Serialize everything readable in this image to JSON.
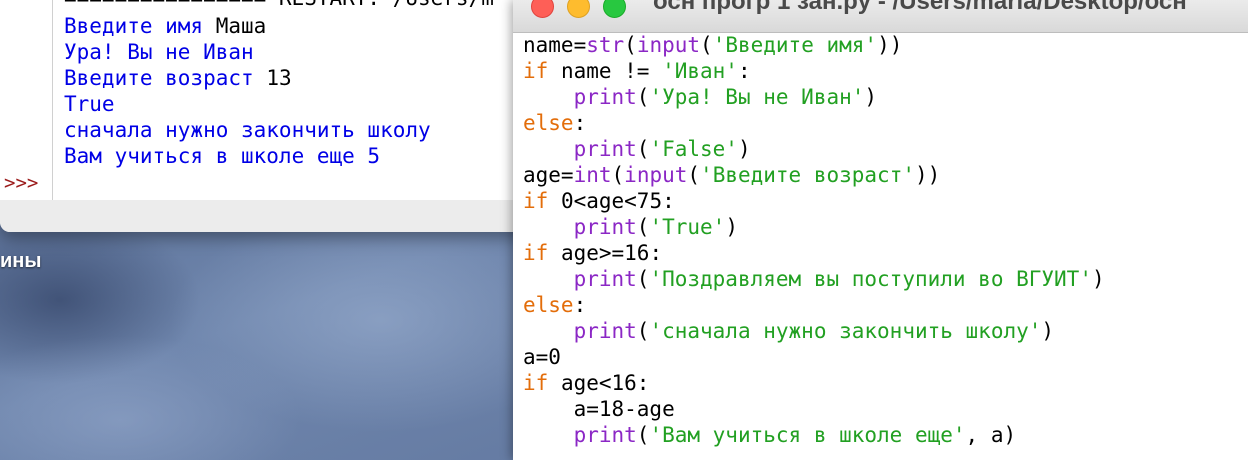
{
  "desktop": {
    "label": "ины"
  },
  "shell": {
    "restart_text": "================ RESTART: /Users/m",
    "prompt": ">>>",
    "output": [
      {
        "prompt_text": "Введите имя",
        "input_text": "Маша"
      },
      {
        "text": "Ура! Вы не Иван"
      },
      {
        "prompt_text": "Введите возраст",
        "input_text": "13"
      },
      {
        "text": "True"
      },
      {
        "text": "сначала нужно закончить школу"
      },
      {
        "text": "Вам учиться в школе еще 5"
      }
    ]
  },
  "editor": {
    "title": "осн прогр 1 зан.py - /Users/maria/Desktop/осн",
    "code": [
      [
        [
          "pl",
          "name="
        ],
        [
          "bi",
          "str"
        ],
        [
          "pl",
          "("
        ],
        [
          "bi",
          "input"
        ],
        [
          "pl",
          "("
        ],
        [
          "st",
          "'Введите имя'"
        ],
        [
          "pl",
          "))"
        ]
      ],
      [
        [
          "kw",
          "if"
        ],
        [
          "pl",
          " name != "
        ],
        [
          "st",
          "'Иван'"
        ],
        [
          "pl",
          ":"
        ]
      ],
      [
        [
          "pl",
          "    "
        ],
        [
          "bi",
          "print"
        ],
        [
          "pl",
          "("
        ],
        [
          "st",
          "'Ура! Вы не Иван'"
        ],
        [
          "pl",
          ")"
        ]
      ],
      [
        [
          "kw",
          "else"
        ],
        [
          "pl",
          ":"
        ]
      ],
      [
        [
          "pl",
          "    "
        ],
        [
          "bi",
          "print"
        ],
        [
          "pl",
          "("
        ],
        [
          "st",
          "'False'"
        ],
        [
          "pl",
          ")"
        ]
      ],
      [
        [
          "pl",
          "age="
        ],
        [
          "bi",
          "int"
        ],
        [
          "pl",
          "("
        ],
        [
          "bi",
          "input"
        ],
        [
          "pl",
          "("
        ],
        [
          "st",
          "'Введите возраст'"
        ],
        [
          "pl",
          "))"
        ]
      ],
      [
        [
          "kw",
          "if"
        ],
        [
          "pl",
          " 0<age<75:"
        ]
      ],
      [
        [
          "pl",
          "    "
        ],
        [
          "bi",
          "print"
        ],
        [
          "pl",
          "("
        ],
        [
          "st",
          "'True'"
        ],
        [
          "pl",
          ")"
        ]
      ],
      [
        [
          "kw",
          "if"
        ],
        [
          "pl",
          " age>=16:"
        ]
      ],
      [
        [
          "pl",
          "    "
        ],
        [
          "bi",
          "print"
        ],
        [
          "pl",
          "("
        ],
        [
          "st",
          "'Поздравляем вы поступили во ВГУИТ'"
        ],
        [
          "pl",
          ")"
        ]
      ],
      [
        [
          "kw",
          "else"
        ],
        [
          "pl",
          ":"
        ]
      ],
      [
        [
          "pl",
          "    "
        ],
        [
          "bi",
          "print"
        ],
        [
          "pl",
          "("
        ],
        [
          "st",
          "'сначала нужно закончить школу'"
        ],
        [
          "pl",
          ")"
        ]
      ],
      [
        [
          "pl",
          "a=0"
        ]
      ],
      [
        [
          "kw",
          "if"
        ],
        [
          "pl",
          " age<16:"
        ]
      ],
      [
        [
          "pl",
          "    a=18-age"
        ]
      ],
      [
        [
          "pl",
          "    "
        ],
        [
          "bi",
          "print"
        ],
        [
          "pl",
          "("
        ],
        [
          "st",
          "'Вам учиться в школе еще'"
        ],
        [
          "pl",
          ", a)"
        ]
      ]
    ]
  },
  "colors": {
    "keyword": "#e36d0a",
    "builtin": "#8b27c5",
    "string": "#22a022",
    "shell_output": "#0000e6",
    "prompt": "#9b1b1b",
    "close": "#fe5f57",
    "minimize": "#febc2e",
    "maximize": "#28c840"
  }
}
